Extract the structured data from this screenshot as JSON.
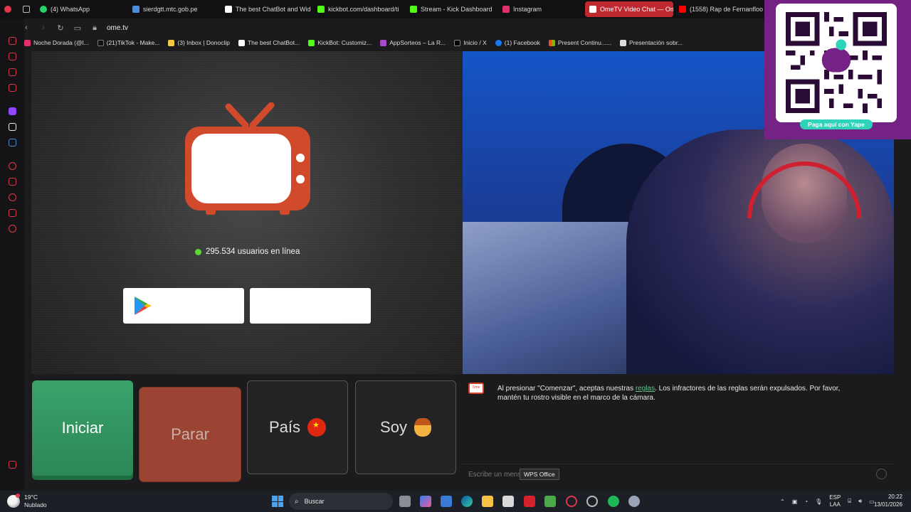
{
  "browser": {
    "tabs": [
      {
        "label": "(4) WhatsApp",
        "color": "#25d366",
        "active": false
      },
      {
        "label": "sierdgtt.mtc.gob.pe",
        "color": "#4c8bd9",
        "active": false
      },
      {
        "label": "The best ChatBot and Wid",
        "color": "#ffffff",
        "active": false
      },
      {
        "label": "kickbot.com/dashboard/ti",
        "color": "#53fc18",
        "active": false
      },
      {
        "label": "Stream - Kick Dashboard",
        "color": "#53fc18",
        "active": false
      },
      {
        "label": "Instagram",
        "color": "#e1306c",
        "active": false
      },
      {
        "label": "OmeTV Video Chat — Om",
        "color": "#ffffff",
        "active": true
      },
      {
        "label": "(1558) Rap de Fernanfloo",
        "color": "#ff0000",
        "active": false
      }
    ],
    "url": "ome.tv",
    "bookmarks": [
      {
        "label": "Noche Dorada (@l...",
        "color": "#e1306c"
      },
      {
        "label": "(21)TikTok - Make...",
        "color": "#111111"
      },
      {
        "label": "(3) Inbox | Donoclip",
        "color": "#f2c744"
      },
      {
        "label": "The best ChatBot...",
        "color": "#ffffff"
      },
      {
        "label": "KickBot: Customiz...",
        "color": "#53fc18"
      },
      {
        "label": "AppSorteos – La R...",
        "color": "#a64ac9"
      },
      {
        "label": "Inicio / X",
        "color": "#000000"
      },
      {
        "label": "(1) Facebook",
        "color": "#1877f2"
      },
      {
        "label": "Present Continu......",
        "color": "#f25022"
      },
      {
        "label": "Presentación sobr...",
        "color": "#dcdcdc"
      }
    ]
  },
  "ome": {
    "online_count": "295.534 usuarios en línea",
    "buttons": {
      "start": "Iniciar",
      "stop": "Parar",
      "country": "País",
      "gender": "Soy"
    },
    "chat": {
      "message_before": "Al presionar \"Comenzar\", aceptas nuestras ",
      "message_link": "reglas",
      "message_after": ". Los infractores de las reglas serán expulsados. Por favor, mantén tu rostro visible en el marco de la cámara.",
      "input_placeholder": "Escribe un mensaje",
      "tooltip": "WPS Office"
    }
  },
  "overlay": {
    "label": "Paga aquí con Yape"
  },
  "taskbar": {
    "temperature": "19°C",
    "weather": "Nublado",
    "search_label": "Buscar",
    "language": "ESP",
    "language_sub": "LAA",
    "time": "20:22",
    "date": "13/01/2026"
  }
}
